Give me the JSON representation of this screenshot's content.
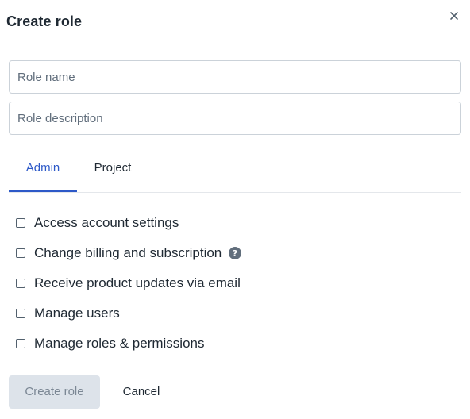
{
  "dialog": {
    "title": "Create role",
    "close_icon": "close-icon"
  },
  "form": {
    "role_name": {
      "value": "",
      "placeholder": "Role name"
    },
    "role_description": {
      "value": "",
      "placeholder": "Role description"
    }
  },
  "tabs": [
    {
      "label": "Admin",
      "active": true
    },
    {
      "label": "Project",
      "active": false
    }
  ],
  "permissions": [
    {
      "label": "Access account settings",
      "checked": false,
      "help_icon": false
    },
    {
      "label": "Change billing and subscription",
      "checked": false,
      "help_icon": true
    },
    {
      "label": "Receive product updates via email",
      "checked": false,
      "help_icon": false
    },
    {
      "label": "Manage users",
      "checked": false,
      "help_icon": false
    },
    {
      "label": "Manage roles & permissions",
      "checked": false,
      "help_icon": false
    }
  ],
  "actions": {
    "create_label": "Create role",
    "create_disabled": true,
    "cancel_label": "Cancel"
  },
  "colors": {
    "accent": "#2d59c8",
    "border": "#cbd2d9",
    "text": "#1f2933",
    "muted_text": "#616e7c",
    "disabled_bg": "#dde3ea",
    "disabled_text": "#7b8794",
    "help_icon": "#616e7c"
  }
}
